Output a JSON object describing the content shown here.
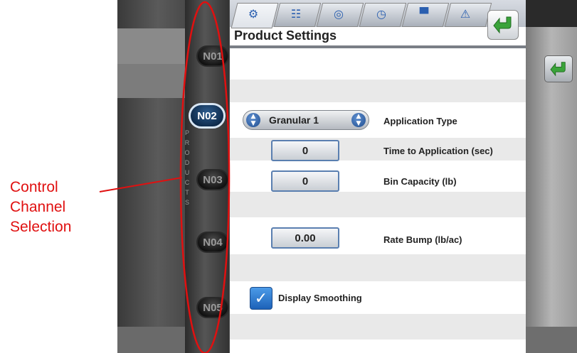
{
  "annotation": {
    "lines": [
      "Control",
      "Channel",
      "Selection"
    ],
    "color": "#e01010"
  },
  "rail": {
    "vertical_text": "PRODUCTS"
  },
  "products": [
    {
      "label": "N01",
      "active": false
    },
    {
      "label": "N02",
      "active": true
    },
    {
      "label": "N03",
      "active": false
    },
    {
      "label": "N04",
      "active": false
    },
    {
      "label": "N05",
      "active": false
    }
  ],
  "tabs": [
    {
      "icon": "planter-icon"
    },
    {
      "icon": "sections-icon"
    },
    {
      "icon": "search-icon"
    },
    {
      "icon": "clock-icon"
    },
    {
      "icon": "display-icon"
    },
    {
      "icon": "warning-icon"
    }
  ],
  "panel": {
    "title": "Product Settings",
    "application_type": {
      "value": "Granular 1",
      "label": "Application Type"
    },
    "time_to_application": {
      "value": "0",
      "label": "Time to Application (sec)"
    },
    "bin_capacity": {
      "value": "0",
      "label": "Bin Capacity (lb)"
    },
    "rate_bump": {
      "value": "0.00",
      "label": "Rate Bump  (lb/ac)"
    },
    "display_smoothing": {
      "label": "Display Smoothing",
      "checked": true
    }
  },
  "colors": {
    "accent_blue": "#1d62b8",
    "back_arrow_green": "#3aa33a"
  }
}
